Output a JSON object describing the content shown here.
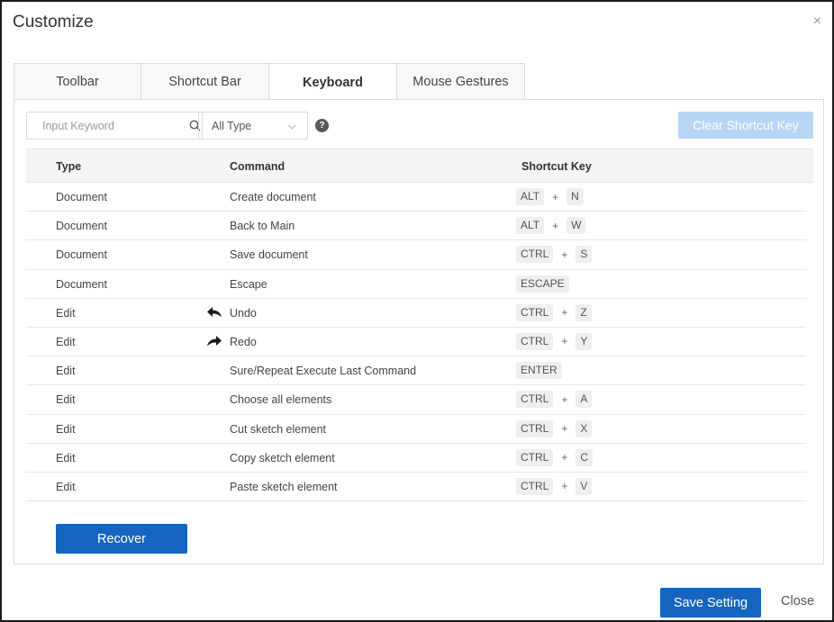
{
  "dialog": {
    "title": "Customize",
    "close_symbol": "×"
  },
  "tabs": [
    {
      "label": "Toolbar",
      "active": false
    },
    {
      "label": "Shortcut Bar",
      "active": false
    },
    {
      "label": "Keyboard",
      "active": true
    },
    {
      "label": "Mouse Gestures",
      "active": false
    }
  ],
  "filter": {
    "search_placeholder": "Input Keyword",
    "search_value": "",
    "type_selected": "All Type",
    "help_symbol": "?",
    "clear_button": "Clear Shortcut Key"
  },
  "table": {
    "columns": {
      "type": "Type",
      "command": "Command",
      "shortcut": "Shortcut Key"
    },
    "rows": [
      {
        "type": "Document",
        "command": "Create document",
        "icon": "",
        "keys": [
          "ALT",
          "N"
        ]
      },
      {
        "type": "Document",
        "command": "Back to Main",
        "icon": "",
        "keys": [
          "ALT",
          "W"
        ]
      },
      {
        "type": "Document",
        "command": "Save document",
        "icon": "",
        "keys": [
          "CTRL",
          "S"
        ]
      },
      {
        "type": "Document",
        "command": "Escape",
        "icon": "",
        "keys": [
          "ESCAPE"
        ]
      },
      {
        "type": "Edit",
        "command": "Undo",
        "icon": "undo-arrow-icon",
        "keys": [
          "CTRL",
          "Z"
        ]
      },
      {
        "type": "Edit",
        "command": "Redo",
        "icon": "redo-arrow-icon",
        "keys": [
          "CTRL",
          "Y"
        ]
      },
      {
        "type": "Edit",
        "command": "Sure/Repeat Execute Last Command",
        "icon": "",
        "keys": [
          "ENTER"
        ]
      },
      {
        "type": "Edit",
        "command": "Choose all elements",
        "icon": "",
        "keys": [
          "CTRL",
          "A"
        ]
      },
      {
        "type": "Edit",
        "command": "Cut sketch element",
        "icon": "",
        "keys": [
          "CTRL",
          "X"
        ]
      },
      {
        "type": "Edit",
        "command": "Copy sketch element",
        "icon": "",
        "keys": [
          "CTRL",
          "C"
        ]
      },
      {
        "type": "Edit",
        "command": "Paste sketch element",
        "icon": "",
        "keys": [
          "CTRL",
          "V"
        ]
      }
    ],
    "key_joiner": "+"
  },
  "buttons": {
    "recover": "Recover",
    "save": "Save Setting",
    "close": "Close"
  },
  "colors": {
    "primary": "#1565c0",
    "disabled_primary": "#b7d6f4",
    "border": "#dcdcdc",
    "header_bg": "#f5f5f5"
  }
}
